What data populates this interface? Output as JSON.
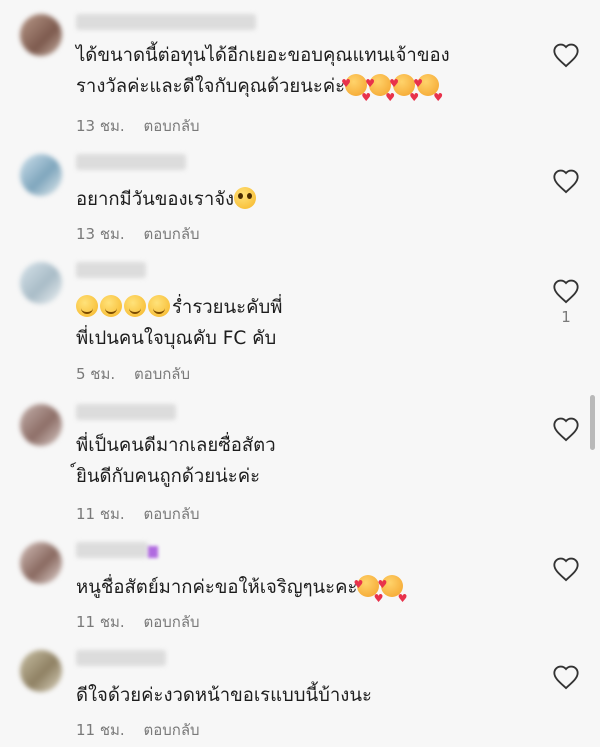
{
  "comments": [
    {
      "text": "ได้ขนาดนี้ต่อทุนได้อีกเยอะขอบคุณแทนเจ้าของ\nรางวัลค่ะและดีใจกับคุณด้วยนะค่ะ",
      "time": "13 ชม.",
      "reply": "ตอบกลับ",
      "likes": "",
      "trailing_emoji": [
        "love-emoji",
        "love-emoji",
        "love-emoji",
        "love-emoji"
      ]
    },
    {
      "text": "อยากมีวันของเราจัง",
      "time": "13 ชม.",
      "reply": "ตอบกลับ",
      "likes": "",
      "trailing_emoji": [
        "pleading-emoji"
      ]
    },
    {
      "leading_emoji": [
        "smile-emoji",
        "smile-emoji",
        "smile-emoji",
        "smile-emoji"
      ],
      "text": "ร่ำรวยนะคับพี่\nพี่เปนคนใจบุณคับ FC คับ",
      "time": "5 ชม.",
      "reply": "ตอบกลับ",
      "likes": "1"
    },
    {
      "text": "พี่เป็นคนดีมากเลยซื่อสัตว\n์ยินดีกับคนถูกด้วยน่ะค่ะ",
      "time": "11 ชม.",
      "reply": "ตอบกลับ",
      "likes": ""
    },
    {
      "text": "หนูชื่อสัตย์มากค่ะขอให้เจริญๆนะคะ",
      "time": "11 ชม.",
      "reply": "ตอบกลับ",
      "likes": "",
      "trailing_emoji": [
        "love-emoji",
        "love-emoji"
      ]
    },
    {
      "text": "ดีใจด้วยค่ะงวดหน้าขอเรแบบนี้บ้างนะ",
      "time": "11 ชม.",
      "reply": "ตอบกลับ",
      "likes": ""
    }
  ],
  "colors": {
    "background": "#f7f7f7",
    "text": "#1d1d1d",
    "meta": "#7a7a7a",
    "heart_outline": "#333333"
  },
  "icons": [
    "heart-outline-icon"
  ]
}
